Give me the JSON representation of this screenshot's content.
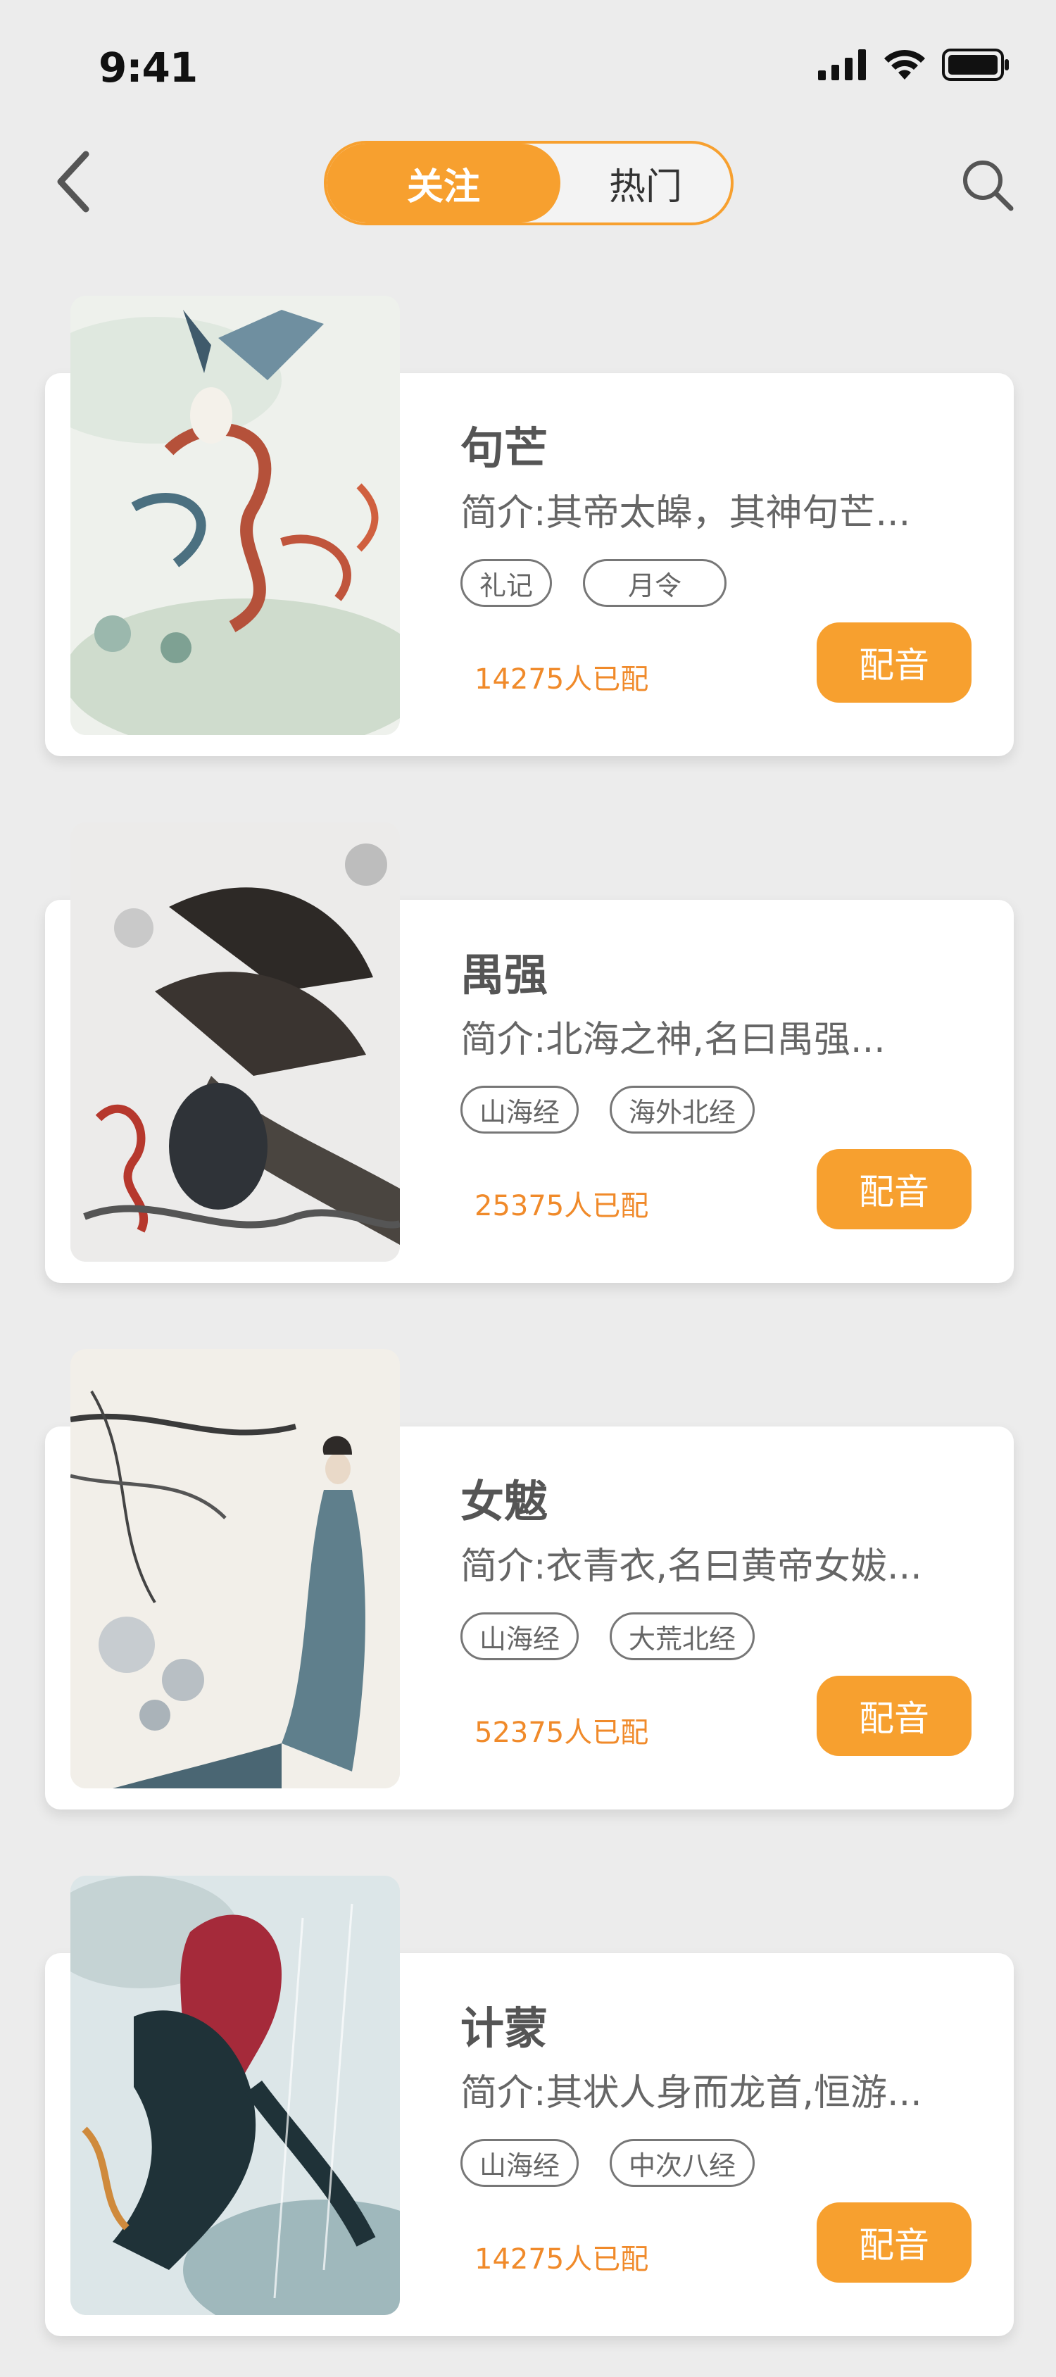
{
  "status_bar": {
    "time": "9:41",
    "icons": [
      "cellular-signal-icon",
      "wifi-icon",
      "battery-icon"
    ]
  },
  "nav": {
    "back_icon": "chevron-left-icon",
    "search_icon": "search-icon",
    "tabs": [
      {
        "label": "关注",
        "active": true
      },
      {
        "label": "热门",
        "active": false
      }
    ]
  },
  "colors": {
    "accent": "#f7a02f",
    "count_text": "#f08a2a",
    "background": "#ececec",
    "card": "#ffffff"
  },
  "cards": [
    {
      "name": "句芒",
      "desc": "简介:其帝太皞，其神句芒...",
      "tags": [
        "礼记",
        "月令"
      ],
      "count": "14275人已配",
      "button": "配音"
    },
    {
      "name": "禺强",
      "desc": "简介:北海之神,名曰禺强...",
      "tags": [
        "山海经",
        "海外北经"
      ],
      "count": "25375人已配",
      "button": "配音"
    },
    {
      "name": "女魃",
      "desc": "简介:衣青衣,名曰黄帝女妭...",
      "tags": [
        "山海经",
        "大荒北经"
      ],
      "count": "52375人已配",
      "button": "配音"
    },
    {
      "name": "计蒙",
      "desc": "简介:其状人身而龙首,恒游...",
      "tags": [
        "山海经",
        "中次八经"
      ],
      "count": "14275人已配",
      "button": "配音"
    }
  ]
}
